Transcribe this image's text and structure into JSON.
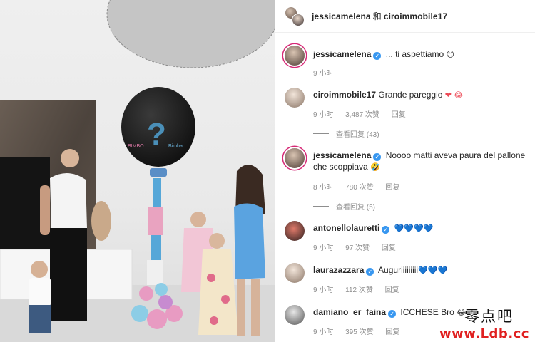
{
  "header": {
    "user1": "jessicamelena",
    "joiner": "和",
    "user2": "ciroimmobile17"
  },
  "balloon": {
    "question_mark": "?",
    "text_left": "BIMBO",
    "text_right": "Bimba"
  },
  "comments": [
    {
      "user": "jessicamelena",
      "verified": true,
      "text": "... ti aspettiamo",
      "emoji": "😊",
      "time": "9 小时",
      "likes": "",
      "reply": ""
    },
    {
      "user": "ciroimmobile17",
      "verified": false,
      "text": "Grande pareggio",
      "emoji": "❤ 😂",
      "time": "9 小时",
      "likes": "3,487 次赞",
      "reply": "回复",
      "view_replies": "查看回复 (43)"
    },
    {
      "user": "jessicamelena",
      "verified": true,
      "text": "Noooo matti aveva paura del pallone che scoppiava",
      "emoji": "🤣",
      "time": "8 小时",
      "likes": "780 次赞",
      "reply": "回复",
      "view_replies": "查看回复 (5)"
    },
    {
      "user": "antonellolauretti",
      "verified": true,
      "text": "",
      "emoji": "💙💙💙💙",
      "time": "9 小时",
      "likes": "97 次赞",
      "reply": "回复"
    },
    {
      "user": "laurazazzara",
      "verified": true,
      "text": "Auguriiiiiiiii",
      "emoji": "💙💙💙",
      "time": "9 小时",
      "likes": "112 次赞",
      "reply": "回复"
    },
    {
      "user": "damiano_er_faina",
      "verified": true,
      "text": "ICCHESE Bro",
      "emoji": "😂",
      "time": "9 小时",
      "likes": "395 次赞",
      "reply": "回复"
    }
  ],
  "watermark": {
    "cn": "零点吧",
    "url": "www.Ldb.cc"
  },
  "colors": {
    "verified": "#3897f0",
    "meta_gray": "#8e8e8e",
    "story_ring": "#d62976",
    "balloon": "#1a1a1a",
    "watermark_red": "#e02020"
  }
}
